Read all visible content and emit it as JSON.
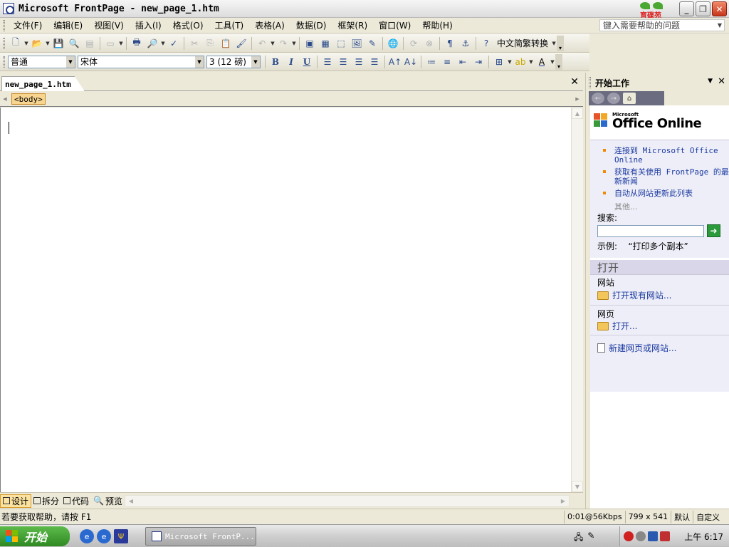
{
  "window": {
    "title": "Microsoft FrontPage - new_page_1.htm",
    "logo_text": "育碟苑"
  },
  "menu": {
    "items": [
      "文件(F)",
      "编辑(E)",
      "视图(V)",
      "插入(I)",
      "格式(O)",
      "工具(T)",
      "表格(A)",
      "数据(D)",
      "框架(R)",
      "窗口(W)",
      "帮助(H)"
    ],
    "help_placeholder": "键入需要帮助的问题"
  },
  "toolbar": {
    "convert_label": "中文简繁转换",
    "style_value": "普通",
    "font_value": "宋体",
    "size_value": "3 (12 磅)",
    "bold_label": "B",
    "italic_label": "I",
    "underline_label": "U"
  },
  "document": {
    "tab_label": "new_page_1.htm",
    "tag_label": "<body>",
    "views": [
      "设计",
      "拆分",
      "代码",
      "预览"
    ],
    "active_view": "设计"
  },
  "taskpane": {
    "title": "开始工作",
    "brand_small": "Microsoft",
    "brand_large": "Office Online",
    "links": [
      "连接到 Microsoft Office Online",
      "获取有关使用 FrontPage 的最新新闻",
      "自动从网站更新此列表"
    ],
    "more_label": "其他...",
    "search_label": "搜索:",
    "example_label": "示例:",
    "example_value": "“打印多个副本”",
    "open_heading": "打开",
    "site_group": "网站",
    "open_site_link": "打开现有网站...",
    "page_group": "网页",
    "open_page_link": "打开...",
    "new_link": "新建网页或网站..."
  },
  "status": {
    "message": "若要获取帮助，请按 F1",
    "speed": "0:01@56Kbps",
    "dimensions": "799 x 541",
    "default_label": "默认",
    "custom_label": "自定义"
  },
  "taskbar": {
    "start_label": "开始",
    "task_label": "Microsoft FrontP...",
    "clock": "上午 6:17"
  },
  "colors": {
    "link": "#1a3aa0",
    "bullet": "#f08a00",
    "start_green": "#2f8a22"
  }
}
